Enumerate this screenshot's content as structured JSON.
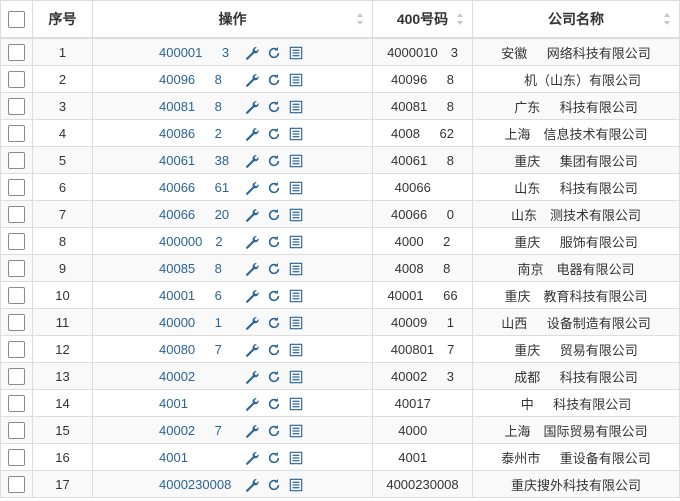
{
  "columns": {
    "seq": "序号",
    "op": "操作",
    "number": "400号码",
    "company": "公司名称"
  },
  "rows": [
    {
      "seq": "1",
      "link": "400001   3",
      "number": "4000010  3",
      "company": "安徽   网络科技有限公司"
    },
    {
      "seq": "2",
      "link": "40096   8",
      "number": "40096   8",
      "company": "  机（山东）有限公司"
    },
    {
      "seq": "3",
      "link": "40081   8",
      "number": "40081   8",
      "company": "广东   科技有限公司"
    },
    {
      "seq": "4",
      "link": "40086   2",
      "number": "4008   62",
      "company": "上海  信息技术有限公司"
    },
    {
      "seq": "5",
      "link": "40061   38",
      "number": "40061   8",
      "company": "重庆   集团有限公司"
    },
    {
      "seq": "6",
      "link": "40066   61",
      "number": "40066   ",
      "company": "山东   科技有限公司"
    },
    {
      "seq": "7",
      "link": "40066   20",
      "number": "40066   0",
      "company": "山东  测技术有限公司"
    },
    {
      "seq": "8",
      "link": "400000  2",
      "number": "4000   2",
      "company": "重庆   服饰有限公司"
    },
    {
      "seq": "9",
      "link": "40085   8",
      "number": "4008   8",
      "company": "南京  电器有限公司"
    },
    {
      "seq": "10",
      "link": "40001   6",
      "number": "40001   66",
      "company": "重庆  教育科技有限公司"
    },
    {
      "seq": "11",
      "link": "40000   1",
      "number": "40009   1",
      "company": "山西   设备制造有限公司"
    },
    {
      "seq": "12",
      "link": "40080   7",
      "number": "400801  7",
      "company": "重庆   贸易有限公司"
    },
    {
      "seq": "13",
      "link": "40002   ",
      "number": "40002   3",
      "company": "成都   科技有限公司"
    },
    {
      "seq": "14",
      "link": "4001   ",
      "number": "40017   ",
      "company": "中   科技有限公司"
    },
    {
      "seq": "15",
      "link": "40002   7",
      "number": "4000   ",
      "company": "上海  国际贸易有限公司"
    },
    {
      "seq": "16",
      "link": "4001   ",
      "number": "4001   ",
      "company": "泰州市   重设备有限公司"
    },
    {
      "seq": "17",
      "link": "4000230008",
      "number": "4000230008",
      "company": "重庆搜外科技有限公司"
    }
  ],
  "icons": {
    "edit": "wrench-icon",
    "refresh": "refresh-icon",
    "detail": "list-icon",
    "sort": "sort-icon"
  },
  "colors": {
    "link": "#2a6496",
    "icon": "#2a6496",
    "border": "#dddddd",
    "stripe": "#f9f9f9"
  }
}
